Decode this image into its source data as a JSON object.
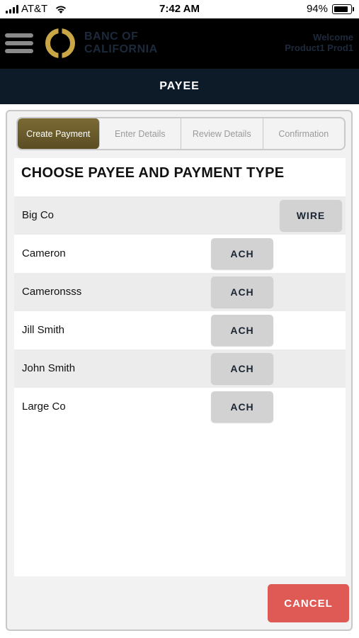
{
  "status_bar": {
    "carrier": "AT&T",
    "time": "7:42 AM",
    "battery_percent_text": "94%",
    "battery_level": 0.94
  },
  "header": {
    "brand_line1": "BANC OF",
    "brand_line2": "CALIFORNIA",
    "welcome_line1": "Welcome",
    "welcome_line2": "Product1 Prod1",
    "logo_color": "#c9a646"
  },
  "title_bar": {
    "title": "PAYEE"
  },
  "steps": [
    {
      "label": "Create Payment",
      "active": true
    },
    {
      "label": "Enter Details",
      "active": false
    },
    {
      "label": "Review Details",
      "active": false
    },
    {
      "label": "Confirmation",
      "active": false
    }
  ],
  "main": {
    "heading": "CHOOSE PAYEE AND PAYMENT TYPE",
    "payees": [
      {
        "name": "Big Co",
        "type": "WIRE"
      },
      {
        "name": "Cameron",
        "type": "ACH"
      },
      {
        "name": "Cameronsss",
        "type": "ACH"
      },
      {
        "name": "Jill Smith",
        "type": "ACH"
      },
      {
        "name": "John Smith",
        "type": "ACH"
      },
      {
        "name": "Large Co",
        "type": "ACH"
      }
    ]
  },
  "footer": {
    "cancel_label": "CANCEL"
  },
  "colors": {
    "accent_gold": "#6b5c2c",
    "title_bar_bg": "#0d1b29",
    "cancel_bg": "#e05a55"
  }
}
